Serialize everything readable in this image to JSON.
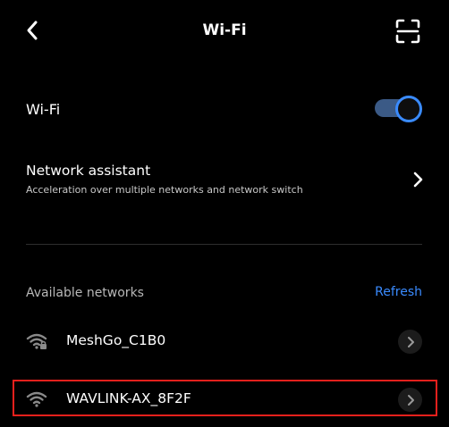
{
  "header": {
    "title": "Wi-Fi",
    "back_icon": "back-arrow-icon",
    "scan_icon": "scan-icon"
  },
  "wifi_toggle": {
    "label": "Wi-Fi",
    "state": "on",
    "accent_color": "#3a8bff"
  },
  "network_assistant": {
    "title": "Network assistant",
    "subtitle": "Acceleration over multiple networks and network switch"
  },
  "available": {
    "label": "Available networks",
    "refresh_label": "Refresh",
    "networks": [
      {
        "name": "MeshGo_C1B0",
        "icon": "wifi-locked-icon"
      },
      {
        "name": "WAVLINK-AX_8F2F",
        "icon": "wifi-icon"
      }
    ]
  },
  "colors": {
    "background": "#000000",
    "accent": "#3a8bff",
    "highlight": "#e8201c"
  }
}
